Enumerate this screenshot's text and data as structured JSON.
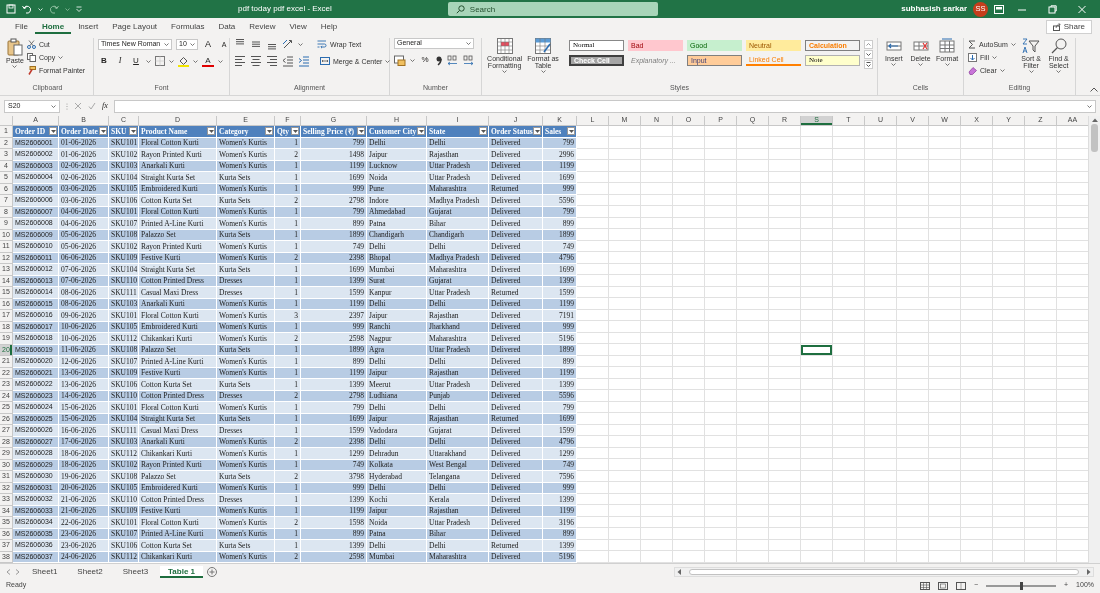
{
  "window": {
    "title": "pdf today pdf excel - Excel",
    "search_placeholder": "Search",
    "user": "subhasish sarkar",
    "avatar": "SS"
  },
  "menu_tabs": [
    {
      "label": "File",
      "selected": false
    },
    {
      "label": "Home",
      "selected": true
    },
    {
      "label": "Insert",
      "selected": false
    },
    {
      "label": "Page Layout",
      "selected": false
    },
    {
      "label": "Formulas",
      "selected": false
    },
    {
      "label": "Data",
      "selected": false
    },
    {
      "label": "Review",
      "selected": false
    },
    {
      "label": "View",
      "selected": false
    },
    {
      "label": "Help",
      "selected": false
    }
  ],
  "share": "Share",
  "ribbon": [
    {
      "kind": "clipboard",
      "label": "Clipboard",
      "paste": "Paste",
      "cut": "Cut",
      "copy": "Copy",
      "format_painter": "Format Painter"
    },
    {
      "kind": "font",
      "label": "Font",
      "font_name": "Times New Roman",
      "font_size": "10",
      "grow_font": "A",
      "shrink_font": "A",
      "bold": "B",
      "italic": "I",
      "underline": "U",
      "font_color": "A"
    },
    {
      "kind": "alignment",
      "label": "Alignment",
      "wrap_text": "Wrap Text",
      "merge": "Merge & Center"
    },
    {
      "kind": "number",
      "label": "Number",
      "format": "General",
      "percent": "%"
    },
    {
      "kind": "styles",
      "label": "Styles",
      "conditional": "Conditional Formatting",
      "format_table": "Format as Table",
      "cell_styles": [
        {
          "label": "Normal",
          "kind": "normal"
        },
        {
          "label": "Bad",
          "kind": "bad"
        },
        {
          "label": "Good",
          "kind": "good"
        },
        {
          "label": "Neutral",
          "kind": "neutral"
        },
        {
          "label": "Calculation",
          "kind": "calculation"
        },
        {
          "label": "Check Cell",
          "kind": "check"
        },
        {
          "label": "Explanatory ...",
          "kind": "explanatory"
        },
        {
          "label": "Input",
          "kind": "input"
        },
        {
          "label": "Linked Cell",
          "kind": "linked"
        },
        {
          "label": "Note",
          "kind": "note"
        }
      ]
    },
    {
      "kind": "cells",
      "label": "Cells",
      "buttons": [
        "Insert",
        "Delete",
        "Format"
      ]
    },
    {
      "kind": "editing",
      "label": "Editing",
      "autosum": "AutoSum",
      "fill": "Fill",
      "clear": "Clear",
      "sort": "Sort & Filter",
      "find": "Find & Select"
    }
  ],
  "formula_bar": {
    "name_box": "S20",
    "fx": "fx"
  },
  "column_letters": [
    {
      "label": "A",
      "selected": false
    },
    {
      "label": "B",
      "selected": false
    },
    {
      "label": "C",
      "selected": false
    },
    {
      "label": "D",
      "selected": false
    },
    {
      "label": "E",
      "selected": false
    },
    {
      "label": "F",
      "selected": false
    },
    {
      "label": "G",
      "selected": false
    },
    {
      "label": "H",
      "selected": false
    },
    {
      "label": "I",
      "selected": false
    },
    {
      "label": "J",
      "selected": false
    },
    {
      "label": "K",
      "selected": false
    },
    {
      "label": "L",
      "selected": false
    },
    {
      "label": "M",
      "selected": false
    },
    {
      "label": "N",
      "selected": false
    },
    {
      "label": "O",
      "selected": false
    },
    {
      "label": "P",
      "selected": false
    },
    {
      "label": "Q",
      "selected": false
    },
    {
      "label": "R",
      "selected": false
    },
    {
      "label": "S",
      "selected": true
    },
    {
      "label": "T",
      "selected": false
    },
    {
      "label": "U",
      "selected": false
    },
    {
      "label": "V",
      "selected": false
    },
    {
      "label": "W",
      "selected": false
    },
    {
      "label": "X",
      "selected": false
    },
    {
      "label": "Y",
      "selected": false
    },
    {
      "label": "Z",
      "selected": false
    },
    {
      "label": "AA",
      "selected": false
    }
  ],
  "row_numbers": [
    {
      "label": "1",
      "selected": false
    },
    {
      "label": "2",
      "selected": false
    },
    {
      "label": "3",
      "selected": false
    },
    {
      "label": "4",
      "selected": false
    },
    {
      "label": "5",
      "selected": false
    },
    {
      "label": "6",
      "selected": false
    },
    {
      "label": "7",
      "selected": false
    },
    {
      "label": "8",
      "selected": false
    },
    {
      "label": "9",
      "selected": false
    },
    {
      "label": "10",
      "selected": false
    },
    {
      "label": "11",
      "selected": false
    },
    {
      "label": "12",
      "selected": false
    },
    {
      "label": "13",
      "selected": false
    },
    {
      "label": "14",
      "selected": false
    },
    {
      "label": "15",
      "selected": false
    },
    {
      "label": "16",
      "selected": false
    },
    {
      "label": "17",
      "selected": false
    },
    {
      "label": "18",
      "selected": false
    },
    {
      "label": "19",
      "selected": false
    },
    {
      "label": "20",
      "selected": true
    },
    {
      "label": "21",
      "selected": false
    },
    {
      "label": "22",
      "selected": false
    },
    {
      "label": "23",
      "selected": false
    },
    {
      "label": "24",
      "selected": false
    },
    {
      "label": "25",
      "selected": false
    },
    {
      "label": "26",
      "selected": false
    },
    {
      "label": "27",
      "selected": false
    },
    {
      "label": "28",
      "selected": false
    },
    {
      "label": "29",
      "selected": false
    },
    {
      "label": "30",
      "selected": false
    },
    {
      "label": "31",
      "selected": false
    },
    {
      "label": "32",
      "selected": false
    },
    {
      "label": "33",
      "selected": false
    },
    {
      "label": "34",
      "selected": false
    },
    {
      "label": "35",
      "selected": false
    },
    {
      "label": "36",
      "selected": false
    },
    {
      "label": "37",
      "selected": false
    },
    {
      "label": "38",
      "selected": false
    }
  ],
  "table": {
    "columns": [
      "Order ID",
      "Order Date",
      "SKU",
      "Product Name",
      "Category",
      "Qty",
      "Selling Price (₹)",
      "Customer City",
      "State",
      "Order Status",
      "Sales"
    ],
    "rows": [
      [
        "MS2606001",
        "01-06-2026",
        "SKU101",
        "Floral Cotton Kurti",
        "Women's Kurtis",
        "1",
        "799",
        "Delhi",
        "Delhi",
        "Delivered",
        "799"
      ],
      [
        "MS2606002",
        "01-06-2026",
        "SKU102",
        "Rayon Printed Kurti",
        "Women's Kurtis",
        "2",
        "1498",
        "Jaipur",
        "Rajasthan",
        "Delivered",
        "2996"
      ],
      [
        "MS2606003",
        "02-06-2026",
        "SKU103",
        "Anarkali Kurti",
        "Women's Kurtis",
        "1",
        "1199",
        "Lucknow",
        "Uttar Pradesh",
        "Delivered",
        "1199"
      ],
      [
        "MS2606004",
        "02-06-2026",
        "SKU104",
        "Straight Kurta Set",
        "Kurta Sets",
        "1",
        "1699",
        "Noida",
        "Uttar Pradesh",
        "Delivered",
        "1699"
      ],
      [
        "MS2606005",
        "03-06-2026",
        "SKU105",
        "Embroidered Kurti",
        "Women's Kurtis",
        "1",
        "999",
        "Pune",
        "Maharashtra",
        "Returned",
        "999"
      ],
      [
        "MS2606006",
        "03-06-2026",
        "SKU106",
        "Cotton Kurta Set",
        "Kurta Sets",
        "2",
        "2798",
        "Indore",
        "Madhya Pradesh",
        "Delivered",
        "5596"
      ],
      [
        "MS2606007",
        "04-06-2026",
        "SKU101",
        "Floral Cotton Kurti",
        "Women's Kurtis",
        "1",
        "799",
        "Ahmedabad",
        "Gujarat",
        "Delivered",
        "799"
      ],
      [
        "MS2606008",
        "04-06-2026",
        "SKU107",
        "Printed A-Line Kurti",
        "Women's Kurtis",
        "1",
        "899",
        "Patna",
        "Bihar",
        "Delivered",
        "899"
      ],
      [
        "MS2606009",
        "05-06-2026",
        "SKU108",
        "Palazzo Set",
        "Kurta Sets",
        "1",
        "1899",
        "Chandigarh",
        "Chandigarh",
        "Delivered",
        "1899"
      ],
      [
        "MS2606010",
        "05-06-2026",
        "SKU102",
        "Rayon Printed Kurti",
        "Women's Kurtis",
        "1",
        "749",
        "Delhi",
        "Delhi",
        "Delivered",
        "749"
      ],
      [
        "MS2606011",
        "06-06-2026",
        "SKU109",
        "Festive Kurti",
        "Women's Kurtis",
        "2",
        "2398",
        "Bhopal",
        "Madhya Pradesh",
        "Delivered",
        "4796"
      ],
      [
        "MS2606012",
        "07-06-2026",
        "SKU104",
        "Straight Kurta Set",
        "Kurta Sets",
        "1",
        "1699",
        "Mumbai",
        "Maharashtra",
        "Delivered",
        "1699"
      ],
      [
        "MS2606013",
        "07-06-2026",
        "SKU110",
        "Cotton Printed Dress",
        "Dresses",
        "1",
        "1399",
        "Surat",
        "Gujarat",
        "Delivered",
        "1399"
      ],
      [
        "MS2606014",
        "08-06-2026",
        "SKU111",
        "Casual Maxi Dress",
        "Dresses",
        "1",
        "1599",
        "Kanpur",
        "Uttar Pradesh",
        "Returned",
        "1599"
      ],
      [
        "MS2606015",
        "08-06-2026",
        "SKU103",
        "Anarkali Kurti",
        "Women's Kurtis",
        "1",
        "1199",
        "Delhi",
        "Delhi",
        "Delivered",
        "1199"
      ],
      [
        "MS2606016",
        "09-06-2026",
        "SKU101",
        "Floral Cotton Kurti",
        "Women's Kurtis",
        "3",
        "2397",
        "Jaipur",
        "Rajasthan",
        "Delivered",
        "7191"
      ],
      [
        "MS2606017",
        "10-06-2026",
        "SKU105",
        "Embroidered Kurti",
        "Women's Kurtis",
        "1",
        "999",
        "Ranchi",
        "Jharkhand",
        "Delivered",
        "999"
      ],
      [
        "MS2606018",
        "10-06-2026",
        "SKU112",
        "Chikankari Kurti",
        "Women's Kurtis",
        "2",
        "2598",
        "Nagpur",
        "Maharashtra",
        "Delivered",
        "5196"
      ],
      [
        "MS2606019",
        "11-06-2026",
        "SKU108",
        "Palazzo Set",
        "Kurta Sets",
        "1",
        "1899",
        "Agra",
        "Uttar Pradesh",
        "Delivered",
        "1899"
      ],
      [
        "MS2606020",
        "12-06-2026",
        "SKU107",
        "Printed A-Line Kurti",
        "Women's Kurtis",
        "1",
        "899",
        "Delhi",
        "Delhi",
        "Delivered",
        "899"
      ],
      [
        "MS2606021",
        "13-06-2026",
        "SKU109",
        "Festive Kurti",
        "Women's Kurtis",
        "1",
        "1199",
        "Jaipur",
        "Rajasthan",
        "Delivered",
        "1199"
      ],
      [
        "MS2606022",
        "13-06-2026",
        "SKU106",
        "Cotton Kurta Set",
        "Kurta Sets",
        "1",
        "1399",
        "Meerut",
        "Uttar Pradesh",
        "Delivered",
        "1399"
      ],
      [
        "MS2606023",
        "14-06-2026",
        "SKU110",
        "Cotton Printed Dress",
        "Dresses",
        "2",
        "2798",
        "Ludhiana",
        "Punjab",
        "Delivered",
        "5596"
      ],
      [
        "MS2606024",
        "15-06-2026",
        "SKU101",
        "Floral Cotton Kurti",
        "Women's Kurtis",
        "1",
        "799",
        "Delhi",
        "Delhi",
        "Delivered",
        "799"
      ],
      [
        "MS2606025",
        "15-06-2026",
        "SKU104",
        "Straight Kurta Set",
        "Kurta Sets",
        "1",
        "1699",
        "Jaipur",
        "Rajasthan",
        "Returned",
        "1699"
      ],
      [
        "MS2606026",
        "16-06-2026",
        "SKU111",
        "Casual Maxi Dress",
        "Dresses",
        "1",
        "1599",
        "Vadodara",
        "Gujarat",
        "Delivered",
        "1599"
      ],
      [
        "MS2606027",
        "17-06-2026",
        "SKU103",
        "Anarkali Kurti",
        "Women's Kurtis",
        "2",
        "2398",
        "Delhi",
        "Delhi",
        "Delivered",
        "4796"
      ],
      [
        "MS2606028",
        "18-06-2026",
        "SKU112",
        "Chikankari Kurti",
        "Women's Kurtis",
        "1",
        "1299",
        "Dehradun",
        "Uttarakhand",
        "Delivered",
        "1299"
      ],
      [
        "MS2606029",
        "18-06-2026",
        "SKU102",
        "Rayon Printed Kurti",
        "Women's Kurtis",
        "1",
        "749",
        "Kolkata",
        "West Bengal",
        "Delivered",
        "749"
      ],
      [
        "MS2606030",
        "19-06-2026",
        "SKU108",
        "Palazzo Set",
        "Kurta Sets",
        "2",
        "3798",
        "Hyderabad",
        "Telangana",
        "Delivered",
        "7596"
      ],
      [
        "MS2606031",
        "20-06-2026",
        "SKU105",
        "Embroidered Kurti",
        "Women's Kurtis",
        "1",
        "999",
        "Delhi",
        "Delhi",
        "Delivered",
        "999"
      ],
      [
        "MS2606032",
        "21-06-2026",
        "SKU110",
        "Cotton Printed Dress",
        "Dresses",
        "1",
        "1399",
        "Kochi",
        "Kerala",
        "Delivered",
        "1399"
      ],
      [
        "MS2606033",
        "21-06-2026",
        "SKU109",
        "Festive Kurti",
        "Women's Kurtis",
        "1",
        "1199",
        "Jaipur",
        "Rajasthan",
        "Delivered",
        "1199"
      ],
      [
        "MS2606034",
        "22-06-2026",
        "SKU101",
        "Floral Cotton Kurti",
        "Women's Kurtis",
        "2",
        "1598",
        "Noida",
        "Uttar Pradesh",
        "Delivered",
        "3196"
      ],
      [
        "MS2606035",
        "23-06-2026",
        "SKU107",
        "Printed A-Line Kurti",
        "Women's Kurtis",
        "1",
        "899",
        "Patna",
        "Bihar",
        "Delivered",
        "899"
      ],
      [
        "MS2606036",
        "23-06-2026",
        "SKU106",
        "Cotton Kurta Set",
        "Kurta Sets",
        "1",
        "1399",
        "Delhi",
        "Delhi",
        "Returned",
        "1399"
      ],
      [
        "MS2606037",
        "24-06-2026",
        "SKU112",
        "Chikankari Kurti",
        "Women's Kurtis",
        "2",
        "2598",
        "Mumbai",
        "Maharashtra",
        "Delivered",
        "5196"
      ]
    ]
  },
  "sheet_tabs": [
    {
      "label": "Sheet1",
      "selected": false
    },
    {
      "label": "Sheet2",
      "selected": false
    },
    {
      "label": "Sheet3",
      "selected": false
    },
    {
      "label": "Table 1",
      "selected": true
    }
  ],
  "status_bar": {
    "status": "Ready",
    "zoom_out": "−",
    "zoom_in": "+",
    "zoom": "100%",
    "zoom_slider": {
      "level": 0.5
    }
  }
}
